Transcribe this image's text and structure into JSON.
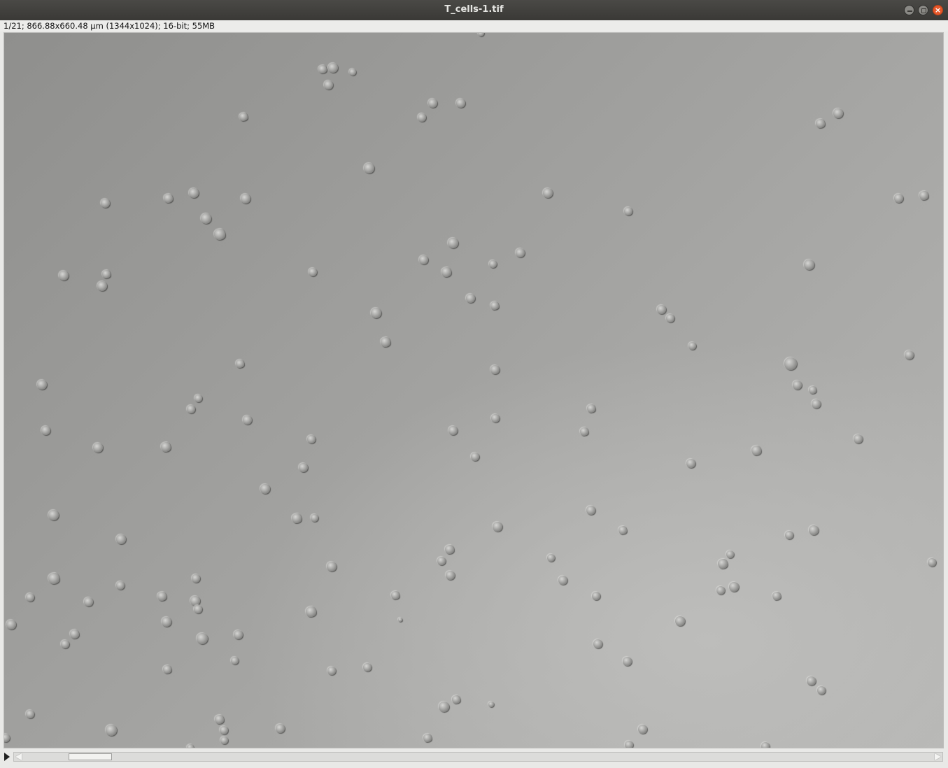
{
  "window": {
    "title": "T_cells-1.tif",
    "buttons": {
      "minimize": "minimize-icon",
      "maximize": "maximize-icon",
      "close": "close-icon"
    },
    "close_glyph": "×",
    "close_color": "#e6572a"
  },
  "image_info": "1/21; 866.88x660.48 µm (1344x1024); 16-bit; 55MB",
  "stack": {
    "current_slice": 1,
    "total_slices": 21,
    "slice_position": 0.05
  }
}
